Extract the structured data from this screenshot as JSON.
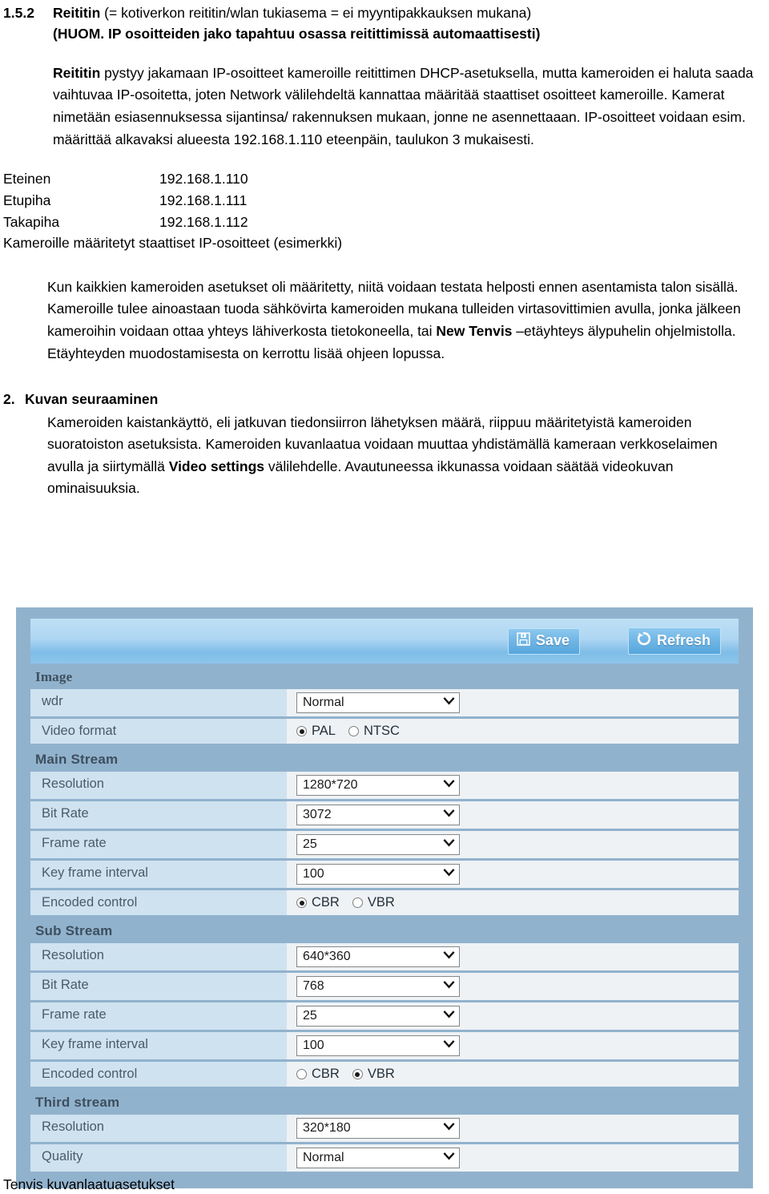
{
  "document": {
    "heading": {
      "number": "1.5.2",
      "bold_lead": "Reititin",
      "rest": " (= kotiverkon reititin/wlan tukiasema = ei myyntipakkauksen mukana)",
      "subheading": "(HUOM.  IP osoitteiden jako tapahtuu osassa reitittimissä automaattisesti)"
    },
    "paragraph1": {
      "bold_lead": "Reititin",
      "rest": " pystyy jakamaan IP-osoitteet kameroille reitittimen DHCP-asetuksella, mutta kameroiden ei haluta saada vaihtuvaa IP-osoitetta, joten Network välilehdeltä kannattaa määritää staattiset osoitteet kameroille. Kamerat nimetään esiasennuksessa sijantinsa/ rakennuksen mukaan, jonne ne asennettaaan.  IP-osoitteet voidaan esim. määrittää alkavaksi alueesta 192.168.1.110 eteenpäin, taulukon 3 mukaisesti."
    },
    "ip_table": {
      "rows": [
        {
          "name": "Eteinen",
          "address": "192.168.1.110"
        },
        {
          "name": "Etupiha",
          "address": "192.168.1.111"
        },
        {
          "name": "Takapiha",
          "address": "192.168.1.112"
        }
      ],
      "caption": "Kameroille määritetyt staattiset IP-osoitteet  (esimerkki)"
    },
    "paragraph2": {
      "part1": "Kun kaikkien kameroiden asetukset oli määritetty, niitä voidaan testata helposti ennen asentamista talon sisällä. Kameroille tulee ainoastaan tuoda sähkövirta kameroiden mukana tulleiden virtasovittimien avulla, jonka jälkeen kameroihin voidaan ottaa yhteys lähiverkosta tietokoneella, tai ",
      "bold": "New Tenvis",
      "part2": " –etäyhteys älypuhelin ohjelmistolla. Etäyhteyden muodostamisesta on kerrottu lisää ohjeen lopussa."
    },
    "section2": {
      "number": "2.",
      "title": "Kuvan seuraaminen",
      "part1": "Kameroiden kaistankäyttö, eli jatkuvan tiedonsiirron lähetyksen määrä, riippuu määritetyistä kameroiden suoratoiston asetuksista. Kameroiden kuvanlaatua voidaan muuttaa yhdistämällä kameraan verkkoselaimen avulla ja siirtymällä ",
      "bold": "Video settings",
      "part2": " välilehdelle. Avautuneessa ikkunassa voidaan säätää videokuvan ominaisuuksia."
    },
    "figure_caption": "Tenvis kuvanlaatuasetukset"
  },
  "camera_ui": {
    "toolbar": {
      "save_label": "Save",
      "save_icon": "floppy-disk-icon",
      "refresh_label": "Refresh",
      "refresh_icon": "refresh-circular-arrow-icon"
    },
    "sections": [
      {
        "title": "Image",
        "rows": [
          {
            "label": "wdr",
            "control": "select",
            "value": "Normal"
          },
          {
            "label": "Video format",
            "control": "radio",
            "options": [
              "PAL",
              "NTSC"
            ],
            "selected": "PAL"
          }
        ]
      },
      {
        "title": "Main Stream",
        "rows": [
          {
            "label": "Resolution",
            "control": "select",
            "value": "1280*720"
          },
          {
            "label": "Bit Rate",
            "control": "select",
            "value": "3072"
          },
          {
            "label": "Frame rate",
            "control": "select",
            "value": "25"
          },
          {
            "label": "Key frame interval",
            "control": "select",
            "value": "100"
          },
          {
            "label": "Encoded control",
            "control": "radio",
            "options": [
              "CBR",
              "VBR"
            ],
            "selected": "CBR"
          }
        ]
      },
      {
        "title": "Sub Stream",
        "rows": [
          {
            "label": "Resolution",
            "control": "select",
            "value": "640*360"
          },
          {
            "label": "Bit Rate",
            "control": "select",
            "value": "768"
          },
          {
            "label": "Frame rate",
            "control": "select",
            "value": "25"
          },
          {
            "label": "Key frame interval",
            "control": "select",
            "value": "100"
          },
          {
            "label": "Encoded control",
            "control": "radio",
            "options": [
              "CBR",
              "VBR"
            ],
            "selected": "VBR"
          }
        ]
      },
      {
        "title": "Third stream",
        "rows": [
          {
            "label": "Resolution",
            "control": "select",
            "value": "320*180"
          },
          {
            "label": "Quality",
            "control": "select",
            "value": "Normal"
          }
        ]
      }
    ],
    "colors": {
      "panel_background": "#91b2cd",
      "label_cell": "#cfe2f0",
      "value_cell": "#eef2f5",
      "toolbar_accent": "#7fbde8",
      "button_text": "#ffffff"
    }
  }
}
